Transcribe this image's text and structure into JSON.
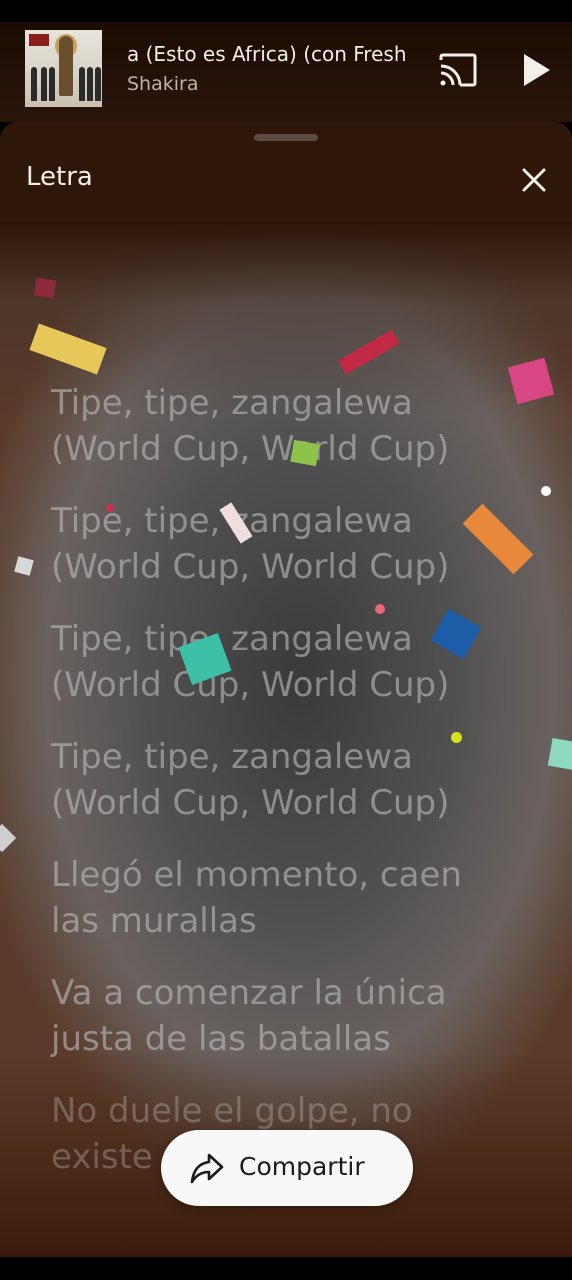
{
  "mini_player": {
    "track_title": "a (Esto es Africa) (con Fresh",
    "artist": "Shakira",
    "cast_icon": "cast-icon",
    "play_icon": "play-icon"
  },
  "lyrics_sheet": {
    "title": "Letra",
    "close_icon": "close-icon",
    "lines": [
      "Tipe, tipe, zangalewa\n(World Cup, World Cup)",
      "Tipe, tipe, zangalewa\n(World Cup, World Cup)",
      "Tipe, tipe, zangalewa\n(World Cup, World Cup)",
      "Tipe, tipe, zangalewa\n(World Cup, World Cup)",
      "Llegó el momento, caen\nlas murallas",
      "Va a comenzar la única\njusta de las batallas",
      "No duele el golpe, no\nexiste"
    ]
  },
  "share_button": {
    "label": "Compartir",
    "icon": "share-icon"
  },
  "colors": {
    "header_bg": "#2a140a",
    "text_light": "#f5efea",
    "lyric_text": "#b9b9b9",
    "share_bg": "#f8f8f8"
  }
}
